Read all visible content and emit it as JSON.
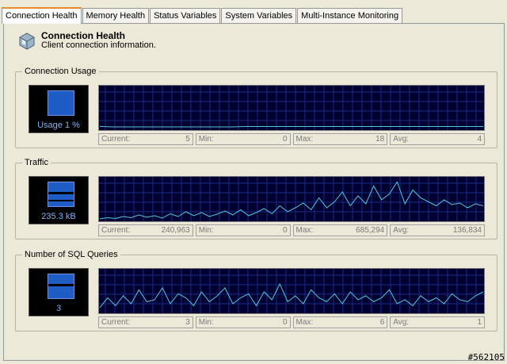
{
  "tabs": [
    {
      "label": "Connection Health",
      "active": true
    },
    {
      "label": "Memory Health",
      "active": false
    },
    {
      "label": "Status Variables",
      "active": false
    },
    {
      "label": "System Variables",
      "active": false
    },
    {
      "label": "Multi-Instance Monitoring",
      "active": false
    }
  ],
  "header": {
    "title": "Connection Health",
    "subtitle": "Client connection information.",
    "icon": "connection-health-icon"
  },
  "groups": [
    {
      "title": "Connection Usage",
      "readout": "Usage 1 %",
      "stats": [
        {
          "label": "Current:",
          "value": "5"
        },
        {
          "label": "Min:",
          "value": "0"
        },
        {
          "label": "Max:",
          "value": "18"
        },
        {
          "label": "Avg:",
          "value": "4"
        }
      ],
      "series": [
        0.05,
        0.04,
        0.04,
        0.04,
        0.04,
        0.04,
        0.04,
        0.04,
        0.04,
        0.04,
        0.04,
        0.05,
        0.05,
        0.05,
        0.05,
        0.05,
        0.05,
        0.05,
        0.05,
        0.05,
        0.05,
        0.05,
        0.05,
        0.05,
        0.05,
        0.05,
        0.05,
        0.05,
        0.05,
        0.05
      ]
    },
    {
      "title": "Traffic",
      "readout": "235.3 kB",
      "stats": [
        {
          "label": "Current:",
          "value": "240,963"
        },
        {
          "label": "Min:",
          "value": "0"
        },
        {
          "label": "Max:",
          "value": "685,294"
        },
        {
          "label": "Avg:",
          "value": "136,834"
        }
      ],
      "series": [
        0.02,
        0.05,
        0.03,
        0.08,
        0.05,
        0.12,
        0.06,
        0.1,
        0.04,
        0.15,
        0.08,
        0.2,
        0.1,
        0.18,
        0.08,
        0.14,
        0.22,
        0.12,
        0.25,
        0.1,
        0.18,
        0.28,
        0.15,
        0.35,
        0.2,
        0.3,
        0.42,
        0.25,
        0.55,
        0.3,
        0.45,
        0.7,
        0.35,
        0.6,
        0.4,
        0.85,
        0.5,
        0.65,
        0.95,
        0.4,
        0.75,
        0.55,
        0.45,
        0.35,
        0.5,
        0.38,
        0.42,
        0.3,
        0.4,
        0.35
      ]
    },
    {
      "title": "Number of SQL Queries",
      "readout": "3",
      "stats": [
        {
          "label": "Current:",
          "value": "3"
        },
        {
          "label": "Min:",
          "value": "0"
        },
        {
          "label": "Max:",
          "value": "6"
        },
        {
          "label": "Avg:",
          "value": "1"
        }
      ],
      "series": [
        0.1,
        0.35,
        0.15,
        0.4,
        0.2,
        0.55,
        0.25,
        0.3,
        0.6,
        0.2,
        0.45,
        0.35,
        0.15,
        0.5,
        0.25,
        0.4,
        0.6,
        0.2,
        0.35,
        0.45,
        0.15,
        0.5,
        0.3,
        0.7,
        0.25,
        0.4,
        0.2,
        0.55,
        0.35,
        0.25,
        0.45,
        0.2,
        0.5,
        0.3,
        0.4,
        0.25,
        0.35,
        0.55,
        0.2,
        0.3,
        0.15,
        0.4,
        0.25,
        0.35,
        0.2,
        0.45,
        0.3,
        0.25,
        0.4,
        0.5
      ]
    }
  ],
  "stamp": "#562105",
  "colors": {
    "graph_bg": "#000030",
    "grid": "#1a2a8a",
    "line": "#4ec9d8",
    "active_tab_accent": "#e68b2c"
  }
}
